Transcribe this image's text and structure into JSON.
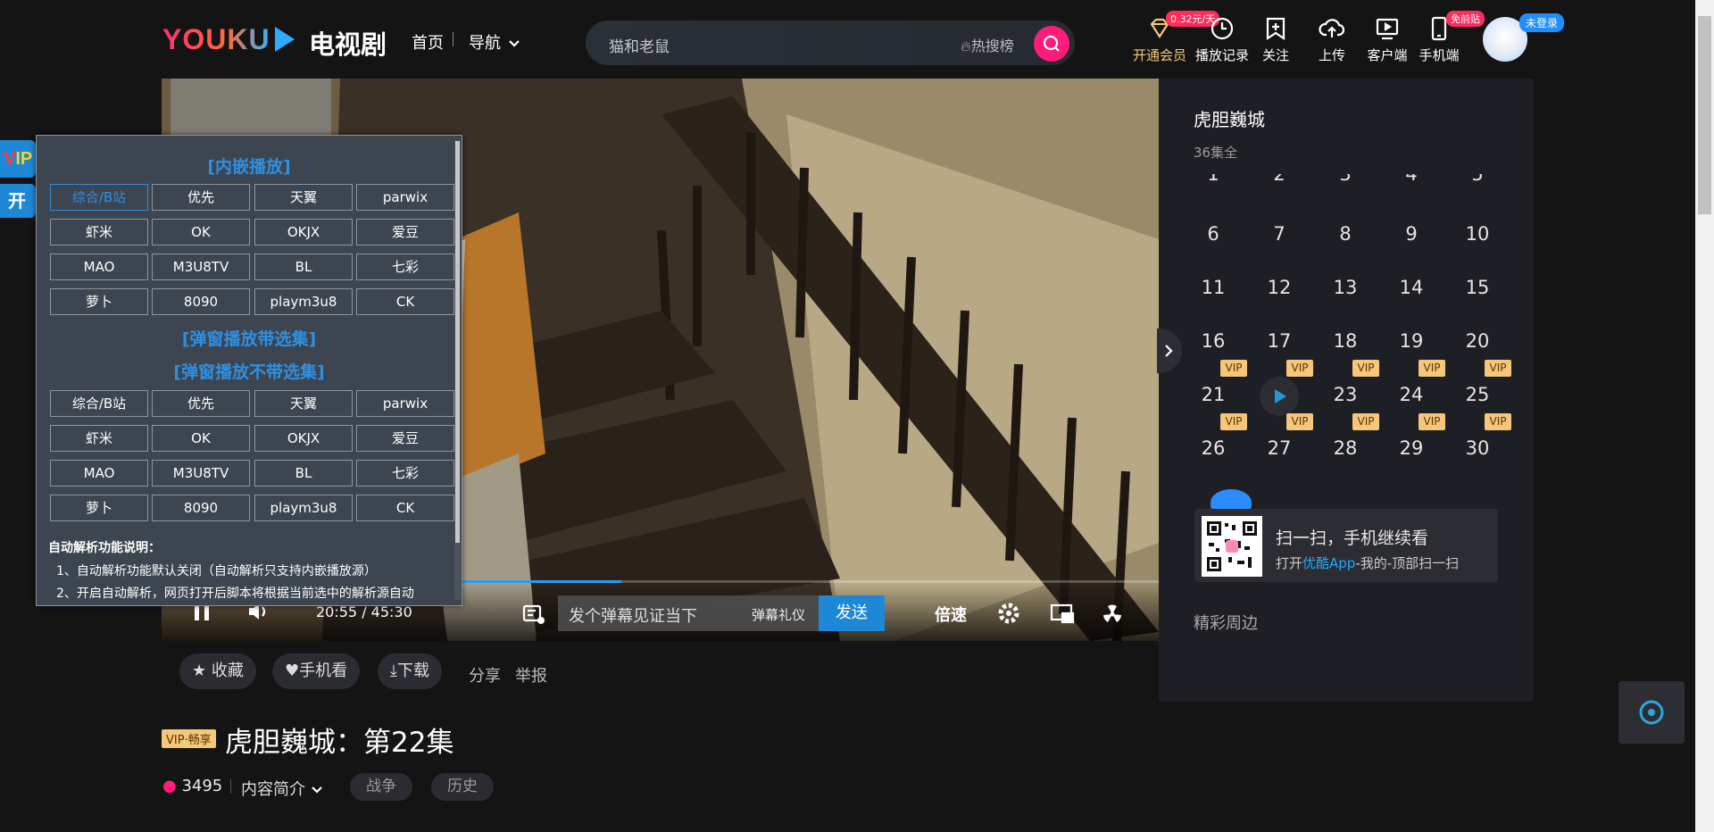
{
  "header": {
    "logo": "YOUKU",
    "channel": "电视剧",
    "nav_home": "首页",
    "nav_guide": "导航",
    "search_value": "猫和老鼠",
    "hot_label": "热搜榜",
    "items": [
      {
        "label": "开通会员",
        "badge": "0.32元/天"
      },
      {
        "label": "播放记录"
      },
      {
        "label": "关注"
      },
      {
        "label": "上传"
      },
      {
        "label": "客户端"
      },
      {
        "label": "手机端",
        "badge": "免前贴"
      }
    ],
    "login_badge": "未登录"
  },
  "player": {
    "time": "20:55 / 45:30",
    "progress": 0.461,
    "danmu_placeholder": "发个弹幕见证当下",
    "danmu_rule": "弹幕礼仪",
    "send_label": "发送",
    "speed_label": "倍速"
  },
  "side": {
    "title": "虎胆巍城",
    "count": "36集全",
    "partial_row": [
      "1",
      "2",
      "3",
      "4",
      "5"
    ],
    "episodes": [
      {
        "n": "6"
      },
      {
        "n": "7"
      },
      {
        "n": "8"
      },
      {
        "n": "9"
      },
      {
        "n": "10"
      },
      {
        "n": "11"
      },
      {
        "n": "12"
      },
      {
        "n": "13"
      },
      {
        "n": "14"
      },
      {
        "n": "15"
      },
      {
        "n": "16"
      },
      {
        "n": "17"
      },
      {
        "n": "18"
      },
      {
        "n": "19"
      },
      {
        "n": "20"
      },
      {
        "n": "21",
        "vip": true
      },
      {
        "n": "22",
        "vip": true,
        "playing": true
      },
      {
        "n": "23",
        "vip": true
      },
      {
        "n": "24",
        "vip": true
      },
      {
        "n": "25",
        "vip": true
      },
      {
        "n": "26",
        "vip": true
      },
      {
        "n": "27",
        "vip": true
      },
      {
        "n": "28",
        "vip": true
      },
      {
        "n": "29",
        "vip": true
      },
      {
        "n": "30",
        "vip": true
      }
    ],
    "vip_label": "VIP",
    "qr_title": "扫一扫，手机继续看",
    "qr_sub_pre": "打开",
    "qr_sub_app": "优酷App",
    "qr_sub_post": "-我的-顶部扫一扫",
    "zhoubian": "精彩周边"
  },
  "actions": {
    "collect": "收藏",
    "phone": "手机看",
    "download": "下载",
    "share": "分享",
    "report": "举报"
  },
  "episode": {
    "vip_tag": "VIP·畅享",
    "title": "虎胆巍城：第22集",
    "heat": "3495",
    "intro": "内容简介",
    "tags": [
      "战争",
      "历史"
    ]
  },
  "plugin": {
    "vip_tab": "VIP",
    "kai_tab": "开",
    "sec_embed": "[内嵌播放]",
    "sec_popup_with": "[弹窗播放带选集]",
    "sec_popup_without": "[弹窗播放不带选集]",
    "grid_a": [
      "综合/B站",
      "优先",
      "天翼",
      "parwix",
      "虾米",
      "OK",
      "OKJX",
      "爱豆",
      "MAO",
      "M3U8TV",
      "BL",
      "七彩",
      "萝卜",
      "8090",
      "playm3u8",
      "CK"
    ],
    "grid_b": [
      "综合/B站",
      "优先",
      "天翼",
      "parwix",
      "虾米",
      "OK",
      "OKJX",
      "爱豆",
      "MAO",
      "M3U8TV",
      "BL",
      "七彩",
      "萝卜",
      "8090",
      "playm3u8",
      "CK"
    ],
    "note_title": "自动解析功能说明：",
    "note_1": "1、自动解析功能默认关闭（自动解析只支持内嵌播放源）",
    "note_2": "2、开启自动解析，网页打开后脚本将根据当前选中的解析源自动"
  },
  "colors": {
    "accent": "#1e88d6",
    "brand_pink": "#ff1b79",
    "vip_gold": "#f5c77a"
  }
}
